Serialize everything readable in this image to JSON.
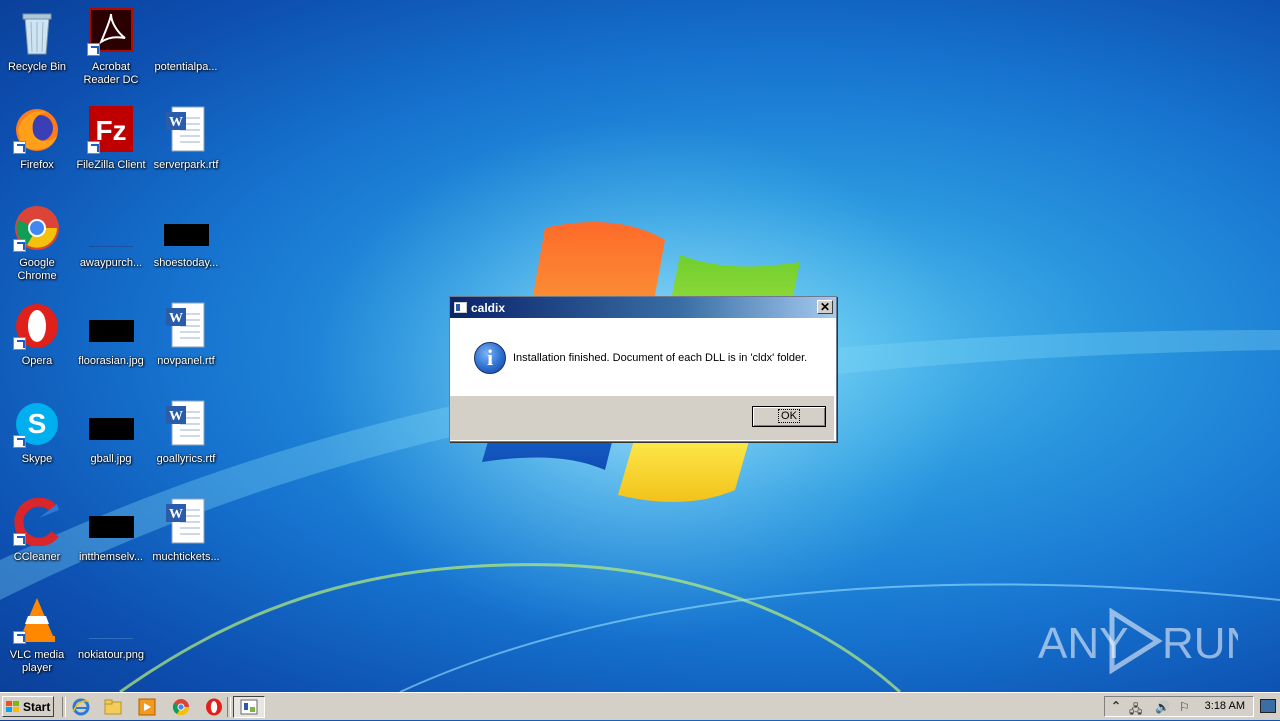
{
  "desktop": {
    "icons": [
      {
        "label": "Recycle Bin"
      },
      {
        "label": "Acrobat Reader DC"
      },
      {
        "label": "potentialpa..."
      },
      {
        "label": "Firefox"
      },
      {
        "label": "FileZilla Client"
      },
      {
        "label": "serverpark.rtf"
      },
      {
        "label": "Google Chrome"
      },
      {
        "label": "awaypurch..."
      },
      {
        "label": "shoestoday..."
      },
      {
        "label": "Opera"
      },
      {
        "label": "floorasian.jpg"
      },
      {
        "label": "novpanel.rtf"
      },
      {
        "label": "Skype"
      },
      {
        "label": "gball.jpg"
      },
      {
        "label": "goallyrics.rtf"
      },
      {
        "label": "CCleaner"
      },
      {
        "label": "intthemselv..."
      },
      {
        "label": "muchtickets..."
      },
      {
        "label": "VLC media player"
      },
      {
        "label": "nokiatour.png"
      }
    ]
  },
  "dialog": {
    "title": "caldix",
    "close_glyph": "✕",
    "message": "Installation finished. Document of each DLL is in 'cldx' folder.",
    "ok_label": "OK",
    "info_glyph": "i"
  },
  "taskbar": {
    "start_label": "Start",
    "clock": "3:18 AM"
  },
  "watermark": {
    "text_left": "ANY",
    "text_right": "RUN"
  }
}
